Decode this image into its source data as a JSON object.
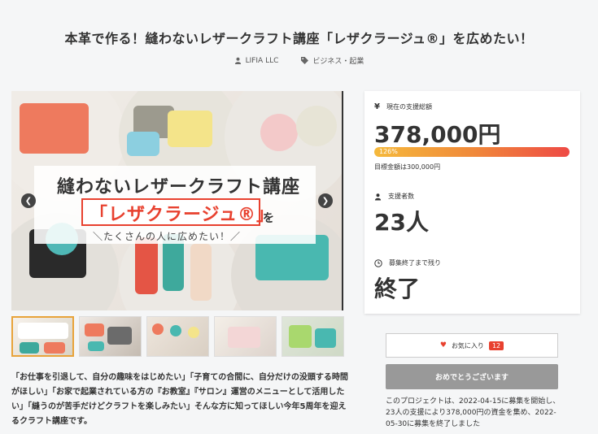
{
  "page": {
    "title": "本革で作る！縫わないレザークラフト講座「レザクラージュ®」を広めたい！"
  },
  "meta": {
    "owner": "LIFIA LLC",
    "category": "ビジネス・起業"
  },
  "hero": {
    "line1": "縫わないレザークラフト講座",
    "line2": "「レザクラージュ®」",
    "line2_suffix": "を",
    "line3": "＼たくさんの人に広めたい！／",
    "prev_icon": "chevron-left-icon",
    "next_icon": "chevron-right-icon"
  },
  "thumbnails": [
    {
      "label": "thumbnail-1",
      "active": true
    },
    {
      "label": "thumbnail-2",
      "active": false
    },
    {
      "label": "thumbnail-3",
      "active": false
    },
    {
      "label": "thumbnail-4",
      "active": false
    },
    {
      "label": "thumbnail-5",
      "active": false
    }
  ],
  "description": "「お仕事を引退して、自分の趣味をはじめたい」「子育ての合間に、自分だけの没頭する時間がほしい」「お家で起業されている方の『お教室』『サロン』運営のメニューとして活用したい」「縫うのが苦手だけどクラフトを楽しみたい」そんな方に知ってほしい今年5周年を迎えるクラフト講座です。",
  "stats": {
    "funding_label": "現在の支援総額",
    "funding_amount": "378,000円",
    "progress_text": "126%",
    "progress_percent": 126,
    "goal_text": "目標金額は300,000円",
    "supporters_label": "支援者数",
    "supporters_value": "23人",
    "remaining_label": "募集終了まで残り",
    "remaining_value": "終了"
  },
  "actions": {
    "favorite_label": "お気に入り",
    "favorite_count": "12",
    "congrats_label": "おめでとうございます"
  },
  "end_note": "このプロジェクトは、2022-04-15に募集を開始し、23人の支援により378,000円の資金を集め、2022-05-30に募集を終了しました",
  "colors": {
    "accent_red": "#e8412f",
    "progress_start": "#f5b93c",
    "progress_end": "#ee4a45",
    "button_gray": "#999999"
  }
}
